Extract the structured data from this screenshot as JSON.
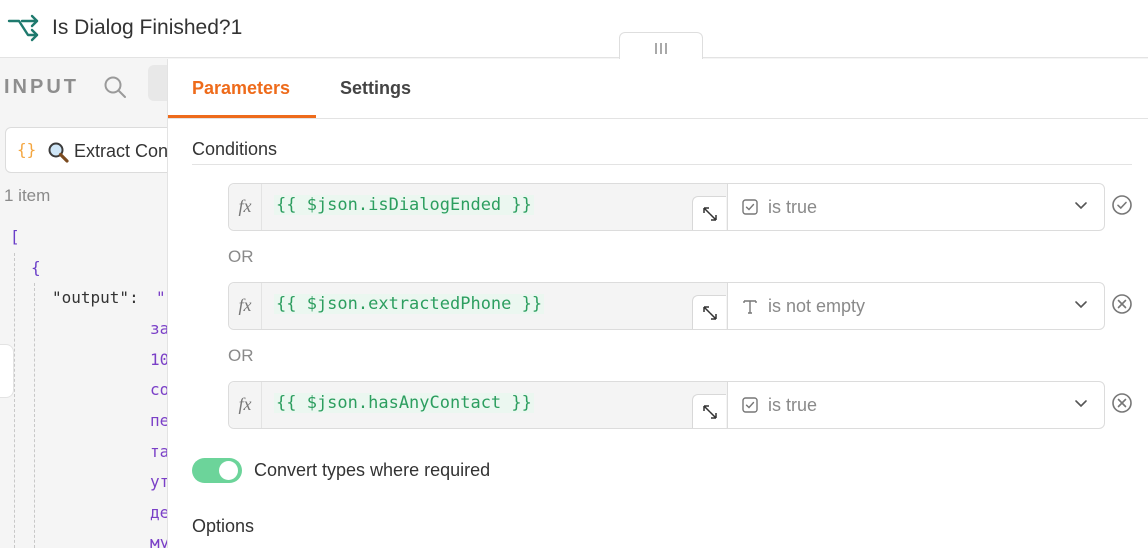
{
  "header": {
    "title": "Is Dialog Finished?1",
    "node_icon": "branch-icon",
    "accent_color": "#1f7a6e"
  },
  "input_panel": {
    "label": "INPUT",
    "search_icon": "search-icon",
    "node_select": {
      "brace": "{}",
      "emoji_icon": "magnifier-icon",
      "label": "Extract Con"
    },
    "item_count": "1 item",
    "json_lines": {
      "open_bracket": "[",
      "open_brace": "{",
      "key": "\"output\":",
      "value_start": "\"",
      "fragments": [
        "за",
        "10",
        "со",
        "пе",
        "та",
        "ут",
        "де",
        "му"
      ]
    }
  },
  "tabs": [
    {
      "label": "Parameters",
      "active": true
    },
    {
      "label": "Settings",
      "active": false
    }
  ],
  "conditions": {
    "label": "Conditions",
    "fx_label": "fx",
    "or_label": "OR",
    "items": [
      {
        "expression": "{{ $json.isDialogEnded }}",
        "operator": "is true",
        "operator_icon": "checkbox-icon"
      },
      {
        "expression": "{{ $json.extractedPhone }}",
        "operator": "is not empty",
        "operator_icon": "text-type-icon"
      },
      {
        "expression": "{{ $json.hasAnyContact }}",
        "operator": "is true",
        "operator_icon": "checkbox-icon"
      }
    ]
  },
  "convert_types": {
    "label": "Convert types where required",
    "enabled": true,
    "color": "#6cd49a"
  },
  "options": {
    "label": "Options"
  },
  "colors": {
    "active_tab": "#ee6b1b",
    "expression": "#2c9e5f",
    "json_string": "#7a3fc7"
  }
}
